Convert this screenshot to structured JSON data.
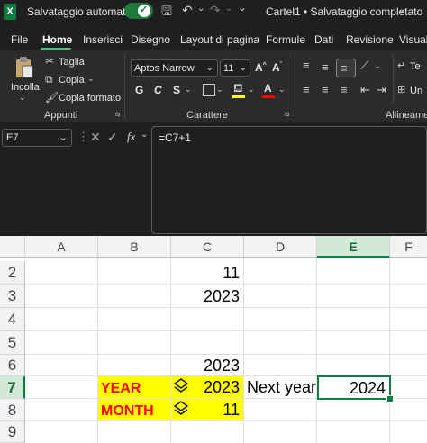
{
  "titlebar": {
    "autosave_label": "Salvataggio automatico",
    "doc_title": "Cartel1 • Salvataggio completato",
    "logo_letter": "X"
  },
  "menu": [
    "File",
    "Home",
    "Inserisci",
    "Disegno",
    "Layout di pagina",
    "Formule",
    "Dati",
    "Revisione",
    "Visualiz"
  ],
  "ribbon": {
    "paste_label": "Incolla",
    "cut_label": "Taglia",
    "copy_label": "Copia",
    "format_painter_label": "Copia formato",
    "clipboard_group": "Appunti",
    "font_name": "Aptos Narrow",
    "font_size": "11",
    "font_group": "Carattere",
    "align_group": "Allineament",
    "bold": "G",
    "italic": "C",
    "underline": "S",
    "grow": "A^",
    "shrink": "Aˇ",
    "te": "Te",
    "un": "Un"
  },
  "formula_bar": {
    "name_box": "E7",
    "fx": "fx",
    "formula": "=C7+1"
  },
  "columns": [
    "A",
    "B",
    "C",
    "D",
    "E",
    "F"
  ],
  "rows": [
    "2",
    "3",
    "4",
    "5",
    "6",
    "7",
    "8",
    "9"
  ],
  "cells": {
    "C2": "11",
    "C3": "2023",
    "C6": "2023",
    "B7": "YEAR",
    "C7": "2023",
    "D7": "Next year",
    "E7": "2024",
    "B8": "MONTH",
    "C8": "11"
  },
  "colors": {
    "accent": "#107c41",
    "highlight": "#ffff00",
    "label_red": "#ff0000"
  }
}
